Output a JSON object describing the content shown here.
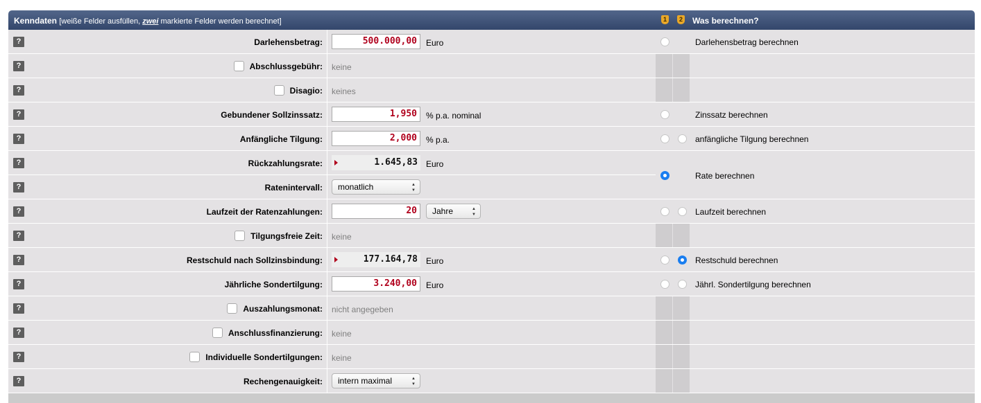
{
  "header": {
    "title": "Kenndaten",
    "subtitle_pre": "[weiße Felder ausfüllen, ",
    "subtitle_em": "zwei",
    "subtitle_post": " markierte Felder werden berechnet]",
    "badge1": "1",
    "badge2": "2",
    "right_title": "Was berechnen?"
  },
  "help_label": "?",
  "rows": [
    {
      "label": "Darlehensbetrag:",
      "value": "500.000,00",
      "unit": "Euro",
      "calc": "Darlehensbetrag berechnen"
    },
    {
      "label": "Abschlussgebühr:",
      "value": "keine"
    },
    {
      "label": "Disagio:",
      "value": "keines"
    },
    {
      "label": "Gebundener Sollzinssatz:",
      "value": "1,950",
      "unit": "% p.a. nominal",
      "calc": "Zinssatz berechnen"
    },
    {
      "label": "Anfängliche Tilgung:",
      "value": "2,000",
      "unit": "% p.a.",
      "calc": "anfängliche Tilgung berechnen"
    },
    {
      "label": "Rückzahlungsrate:",
      "value": "1.645,83",
      "unit": "Euro",
      "calc": "Rate berechnen"
    },
    {
      "label": "Ratenintervall:",
      "value": "monatlich"
    },
    {
      "label": "Laufzeit der Ratenzahlungen:",
      "value": "20",
      "unit_select": "Jahre",
      "calc": "Laufzeit berechnen"
    },
    {
      "label": "Tilgungsfreie Zeit:",
      "value": "keine"
    },
    {
      "label": "Restschuld nach Sollzinsbindung:",
      "value": "177.164,78",
      "unit": "Euro",
      "calc": "Restschuld berechnen"
    },
    {
      "label": "Jährliche Sondertilgung:",
      "value": "3.240,00",
      "unit": "Euro",
      "calc": "Jährl. Sondertilgung berechnen"
    },
    {
      "label": "Auszahlungsmonat:",
      "value": "nicht angegeben"
    },
    {
      "label": "Anschlussfinanzierung:",
      "value": "keine"
    },
    {
      "label": "Individuelle Sondertilgungen:",
      "value": "keine"
    },
    {
      "label": "Rechengenauigkeit:",
      "value": "intern maximal"
    }
  ],
  "selection": {
    "calc1": "Rate berechnen",
    "calc2": "Restschuld berechnen"
  },
  "colors": {
    "header": "#3d5175",
    "row_bg": "#e4e2e4",
    "value_red": "#b0001c",
    "radio_on": "#1a7ef0",
    "badge": "#e9a728"
  },
  "icons": {
    "result_marker": "triangle-right-icon",
    "select_arrow": "chevron-updown-icon"
  }
}
